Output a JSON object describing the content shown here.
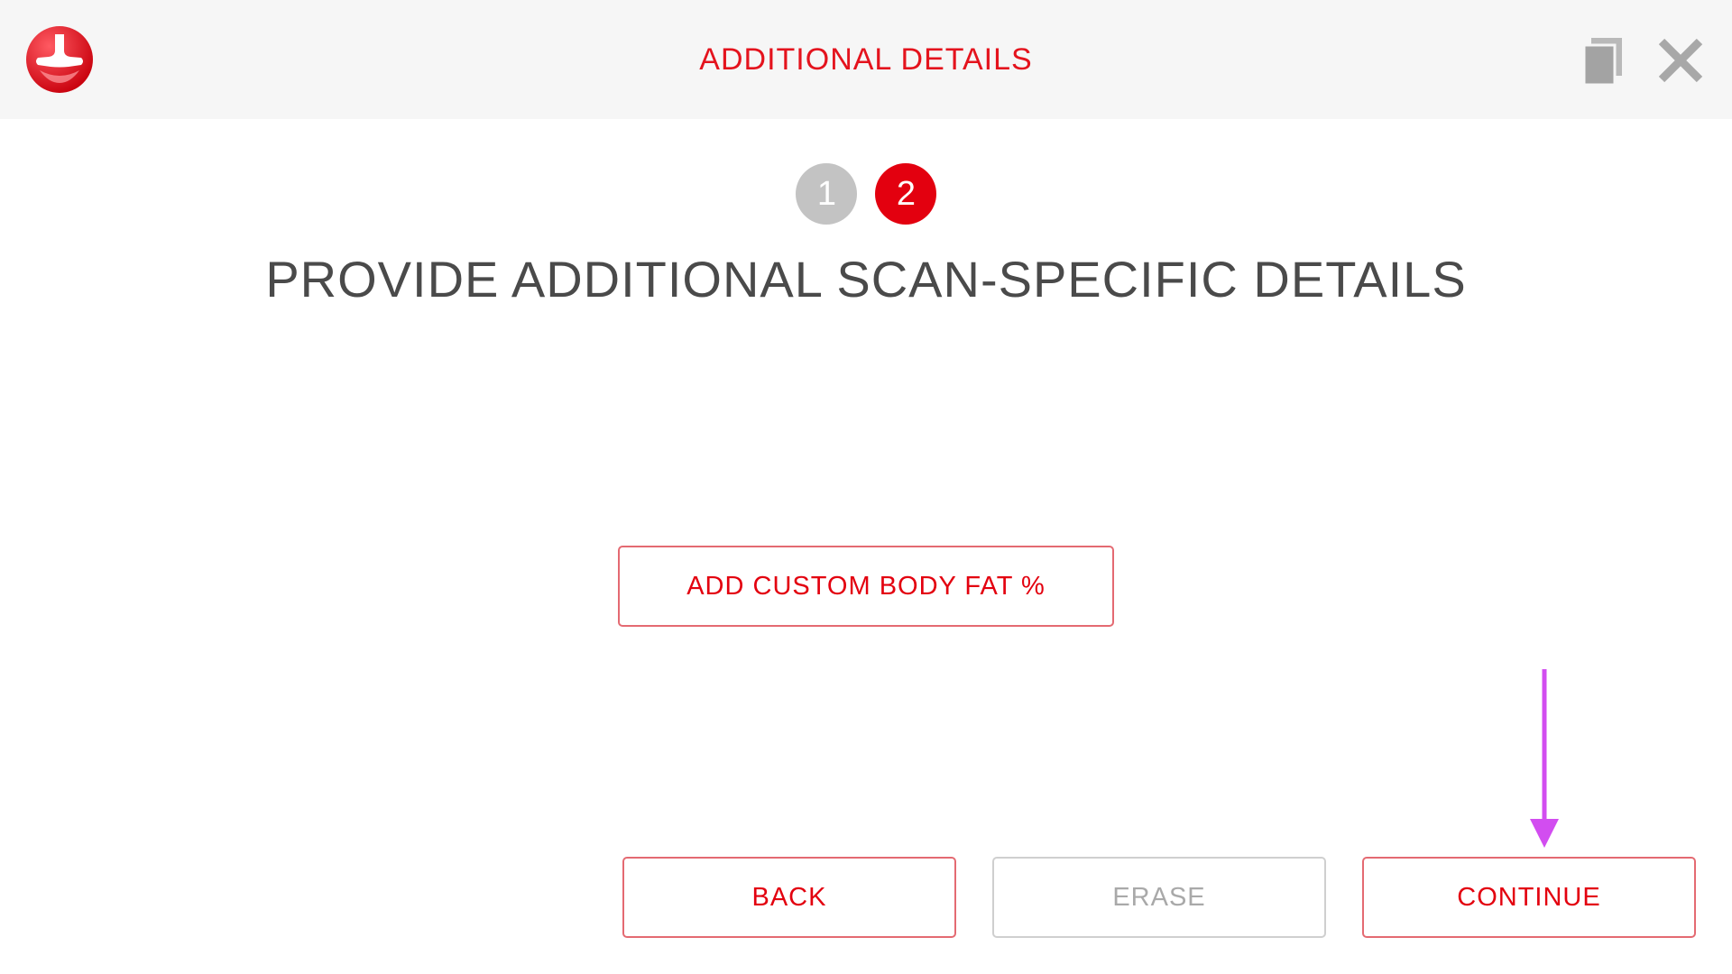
{
  "header": {
    "title": "ADDITIONAL DETAILS",
    "logo_icon": "brand-logo-icon",
    "copy_icon": "copy-icon",
    "close_icon": "close-icon"
  },
  "steps": [
    {
      "label": "1",
      "state": "completed"
    },
    {
      "label": "2",
      "state": "active"
    }
  ],
  "main": {
    "heading": "PROVIDE ADDITIONAL SCAN-SPECIFIC DETAILS",
    "add_body_fat_label": "ADD CUSTOM BODY FAT %"
  },
  "footer": {
    "back_label": "BACK",
    "erase_label": "ERASE",
    "continue_label": "CONTINUE"
  },
  "annotation": {
    "icon": "down-arrow-icon",
    "color": "#d24df0"
  },
  "colors": {
    "accent": "#e3000f",
    "step_inactive": "#c3c3c3",
    "header_bg": "#f6f6f6",
    "heading_text": "#4a4a4a",
    "disabled_text": "#a9a9a9"
  }
}
